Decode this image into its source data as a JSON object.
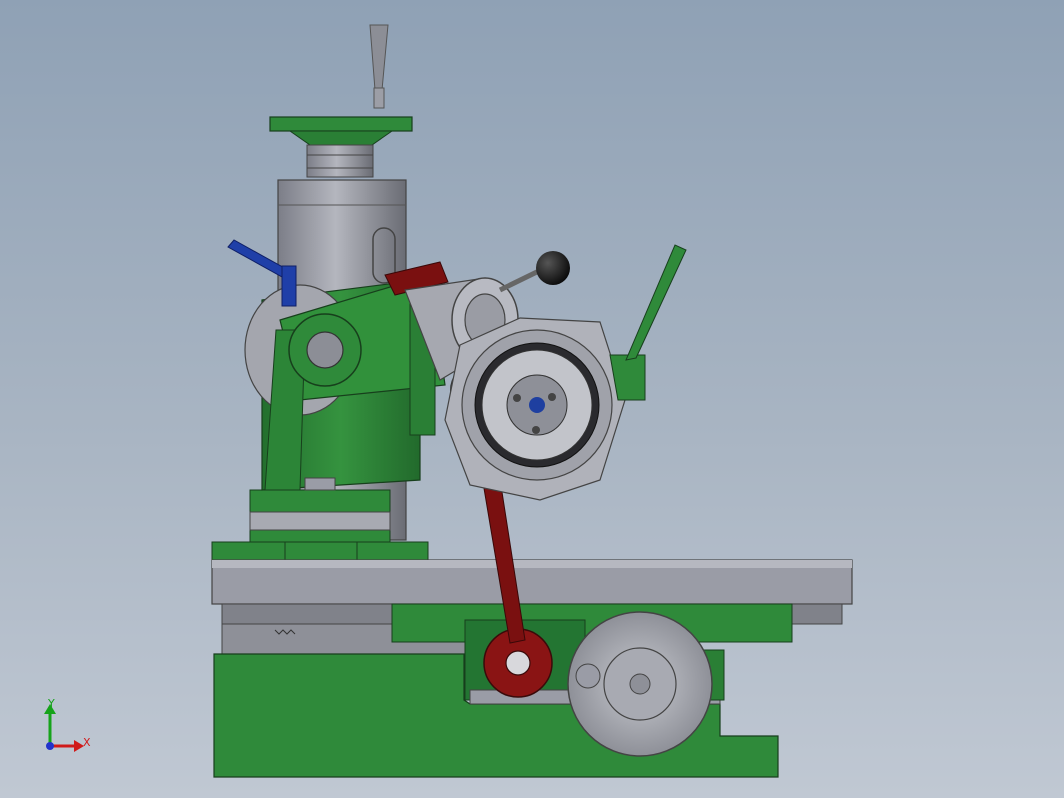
{
  "viewport": {
    "background_top": "#8fa1b5",
    "background_bottom": "#c0c8d3"
  },
  "model": {
    "colors": {
      "green": "#2f8a3a",
      "green_dark": "#1f6a2a",
      "gray": "#9a9ca6",
      "gray_dark": "#6e7078",
      "red_handle": "#7a1010",
      "blue_handle": "#1f3fa8",
      "knob": "#141414"
    }
  },
  "triad": {
    "x_label": "X",
    "y_label": "Y",
    "x_color": "#d01a1a",
    "y_color": "#16a31a",
    "z_color": "#2233cc"
  }
}
